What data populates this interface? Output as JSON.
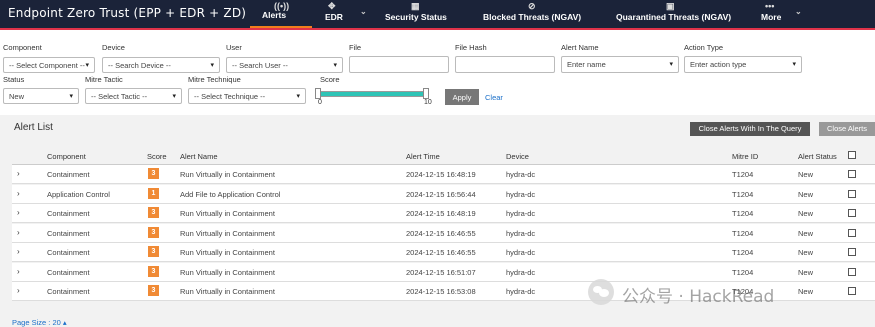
{
  "app": {
    "title": "Endpoint Zero Trust (EPP + EDR + ZD)"
  },
  "nav": {
    "alerts": "Alerts",
    "edr": "EDR",
    "security_status": "Security Status",
    "blocked_threats": "Blocked Threats (NGAV)",
    "quarantined_threats": "Quarantined Threats (NGAV)",
    "more": "More"
  },
  "filters": {
    "component": {
      "label": "Component",
      "value": "-- Select Component --"
    },
    "device": {
      "label": "Device",
      "value": "-- Search Device --"
    },
    "user": {
      "label": "User",
      "value": "-- Search User --"
    },
    "file": {
      "label": "File",
      "value": ""
    },
    "file_hash": {
      "label": "File Hash",
      "value": ""
    },
    "alert_name": {
      "label": "Alert Name",
      "placeholder": "Enter name"
    },
    "action_type": {
      "label": "Action Type",
      "placeholder": "Enter action type"
    },
    "status": {
      "label": "Status",
      "value": "New"
    },
    "mitre_tactic": {
      "label": "Mitre Tactic",
      "value": "-- Select Tactic --"
    },
    "mitre_technique": {
      "label": "Mitre Technique",
      "value": "-- Select Technique --"
    },
    "score": {
      "label": "Score",
      "min": "0",
      "max": "10",
      "fill_fraction": 1.0
    },
    "apply_label": "Apply",
    "clear_label": "Clear"
  },
  "alert_list": {
    "title": "Alert List",
    "close_within_query_label": "Close Alerts With In The Query",
    "close_alerts_label": "Close Alerts",
    "columns": {
      "component": "Component",
      "score": "Score",
      "alert_name": "Alert Name",
      "alert_time": "Alert Time",
      "device": "Device",
      "mitre_id": "Mitre ID",
      "alert_status": "Alert Status"
    },
    "rows": [
      {
        "component": "Containment",
        "score": "3",
        "alert_name": "Run Virtually in Containment",
        "alert_time": "2024-12-15 16:48:19",
        "device": "hydra-dc",
        "mitre_id": "T1204",
        "status": "New"
      },
      {
        "component": "Application Control",
        "score": "1",
        "alert_name": "Add File to Application Control",
        "alert_time": "2024-12-15 16:56:44",
        "device": "hydra-dc",
        "mitre_id": "T1204",
        "status": "New"
      },
      {
        "component": "Containment",
        "score": "3",
        "alert_name": "Run Virtually in Containment",
        "alert_time": "2024-12-15 16:48:19",
        "device": "hydra-dc",
        "mitre_id": "T1204",
        "status": "New"
      },
      {
        "component": "Containment",
        "score": "3",
        "alert_name": "Run Virtually in Containment",
        "alert_time": "2024-12-15 16:46:55",
        "device": "hydra-dc",
        "mitre_id": "T1204",
        "status": "New"
      },
      {
        "component": "Containment",
        "score": "3",
        "alert_name": "Run Virtually in Containment",
        "alert_time": "2024-12-15 16:46:55",
        "device": "hydra-dc",
        "mitre_id": "T1204",
        "status": "New"
      },
      {
        "component": "Containment",
        "score": "3",
        "alert_name": "Run Virtually in Containment",
        "alert_time": "2024-12-15 16:51:07",
        "device": "hydra-dc",
        "mitre_id": "T1204",
        "status": "New"
      },
      {
        "component": "Containment",
        "score": "3",
        "alert_name": "Run Virtually in Containment",
        "alert_time": "2024-12-15 16:53:08",
        "device": "hydra-dc",
        "mitre_id": "T1204",
        "status": "New"
      }
    ],
    "page_size": "Page Size : 20"
  },
  "watermark": {
    "text": "公众号 · HackRead"
  },
  "colors": {
    "nav_bg": "#1b2339",
    "accent_red": "#e0334a",
    "active_tab": "#f07f1c",
    "score_badge": "#f08a35",
    "slider": "#2ec4b6",
    "link": "#1a6fc9"
  }
}
